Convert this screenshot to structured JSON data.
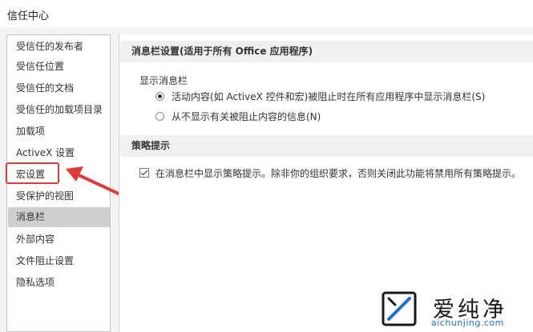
{
  "window": {
    "title": "信任中心"
  },
  "sidebar": {
    "items": [
      {
        "label": "受信任的发布者"
      },
      {
        "label": "受信任位置"
      },
      {
        "label": "受信任的文档"
      },
      {
        "label": "受信任的加载项目录"
      },
      {
        "label": "加载项"
      },
      {
        "label": "ActiveX 设置"
      },
      {
        "label": "宏设置"
      },
      {
        "label": "受保护的视图"
      },
      {
        "label": "消息栏"
      },
      {
        "label": "外部内容"
      },
      {
        "label": "文件阻止设置"
      },
      {
        "label": "隐私选项"
      }
    ],
    "selected": "消息栏",
    "highlighted": "宏设置"
  },
  "main": {
    "message_bar": {
      "header": "消息栏设置(适用于所有 Office 应用程序)",
      "group_label": "显示消息栏",
      "options": [
        {
          "label": "活动内容(如 ActiveX 控件和宏)被阻止时在所有应用程序中显示消息栏(S)",
          "checked": true
        },
        {
          "label": "从不显示有关被阻止内容的信息(N)",
          "checked": false
        }
      ]
    },
    "policy_tips": {
      "header": "策略提示",
      "checkbox": {
        "label": "在消息栏中显示策略提示。除非你的组织要求，否则关闭此功能将禁用所有策略提示。",
        "checked": true
      }
    }
  },
  "watermark": {
    "text": "爱纯净",
    "url": "aichunjing.com"
  },
  "colors": {
    "highlight": "#e03b3b",
    "selected_bg": "#cfcfcf",
    "section_bg": "#f0f0f0",
    "watermark_url": "#1f6fd1"
  }
}
